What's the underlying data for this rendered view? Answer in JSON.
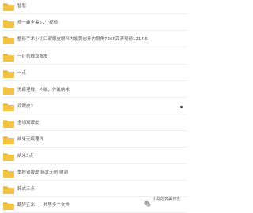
{
  "folders": [
    {
      "name": "智慧"
    },
    {
      "name": "郑一峰全集51个视频"
    },
    {
      "name": "整形手术小切口双眼皮眼科内眦赘皮开内眼角720P高清视频1217.5"
    },
    {
      "name": "一针抗线双眼皮"
    },
    {
      "name": "一点"
    },
    {
      "name": "无痕埋线，内眦，外眦纳米"
    },
    {
      "name": "双眼皮2"
    },
    {
      "name": "全切双眼皮"
    },
    {
      "name": "纳米无痕埋线"
    },
    {
      "name": "纳米3点"
    },
    {
      "name": "重睑双眼皮 韩式无创 倒到"
    },
    {
      "name": "韩式三点"
    },
    {
      "name": "翻转正米，一共等多个文件"
    }
  ],
  "colors": {
    "folder_body": "#f5c342",
    "folder_tab": "#e8a92a",
    "text": "#555555"
  },
  "watermark": {
    "icon": "wechat-icon",
    "text": "小胡的变美日志"
  }
}
